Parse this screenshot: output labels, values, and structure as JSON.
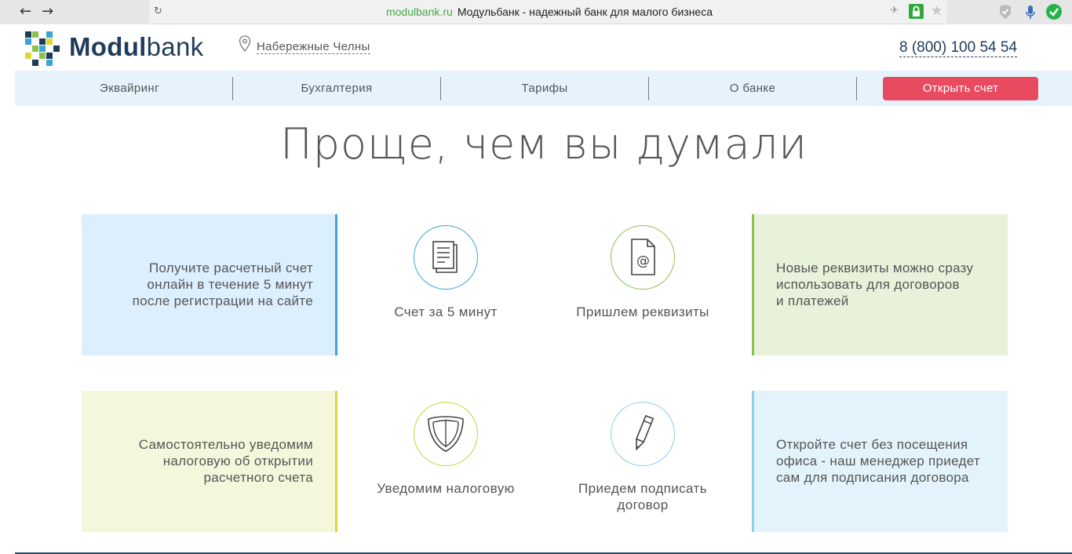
{
  "browser": {
    "url_domain": "modulbank.ru",
    "page_title": "Модульбанк - надежный банк для малого бизнеса"
  },
  "header": {
    "logo_bold": "Modul",
    "logo_light": "bank",
    "city": "Набережные Челны",
    "phone": "8 (800) 100 54 54"
  },
  "menu": {
    "items": [
      "Эквайринг",
      "Бухгалтерия",
      "Тарифы",
      "О банке"
    ],
    "cta": "Открыть счет"
  },
  "headline": "Проще, чем вы думали",
  "features": {
    "row1": {
      "left_box": "Получите расчетный счет\nонлайн в течение 5 минут\nпосле регистрации на сайте",
      "icon1_label": "Счет за 5 минут",
      "icon2_label": "Пришлем реквизиты",
      "right_box": "Новые реквизиты можно сразу\nиспользовать для договоров\nи платежей"
    },
    "row2": {
      "left_box": "Самостоятельно уведомим\nналоговую об открытии\nрасчетного счета",
      "icon1_label": "Уведомим налоговую",
      "icon2_label": "Приедем подписать\nдоговор",
      "right_box": "Откройте счет без посещения\nофиса - наш менеджер приедет\nсам для подписания договора"
    }
  },
  "colors": {
    "brand_navy": "#1f3c5a",
    "cta_red": "#e84a5f",
    "menu_bg": "#e6f3fc",
    "blue_box": "#dcefff",
    "blue_accent": "#3aa3d9",
    "green_box": "#e8f2da",
    "green_accent": "#8cc04f",
    "yellow_box": "#f5f7dc",
    "yellow_accent": "#d9d93a",
    "lightblue_box": "#e3f3fb",
    "lightblue_accent": "#8fcde8"
  }
}
